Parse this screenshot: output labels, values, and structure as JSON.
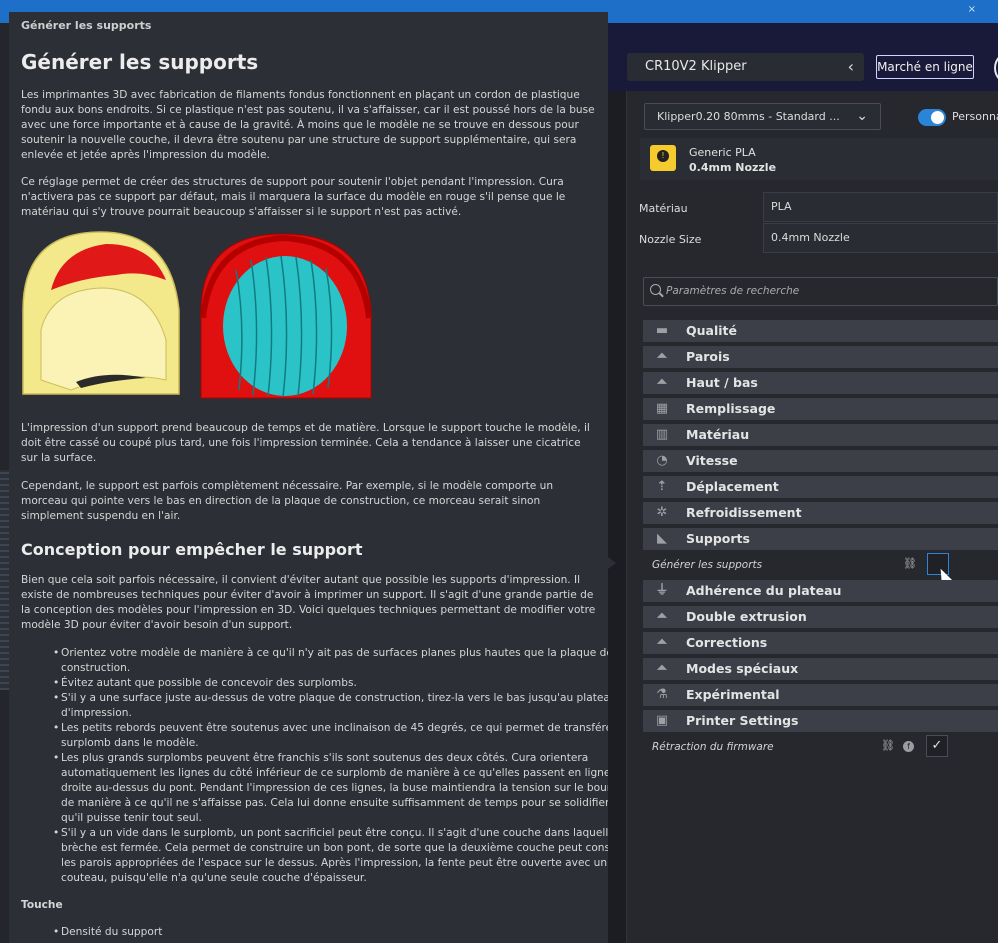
{
  "window": {
    "close_glyph": "×"
  },
  "header": {
    "printer_name": "CR10V2 Klipper",
    "marketplace_label": "Marché en ligne"
  },
  "tooltip": {
    "crumb": "Générer les supports",
    "title": "Générer les supports",
    "para1": "Les imprimantes 3D avec fabrication de filaments fondus fonctionnent en plaçant un cordon de plastique fondu aux bons endroits. Si ce plastique n'est pas soutenu, il va s'affaisser, car il est poussé hors de la buse avec une force importante et à cause de la gravité. À moins que le modèle ne se trouve en dessous pour soutenir la nouvelle couche, il devra être soutenu par une structure de support supplémentaire, qui sera enlevée et jetée après l'impression du modèle.",
    "para2": "Ce réglage permet de créer des structures de support pour soutenir l'objet pendant l'impression. Cura n'activera pas ce support par défaut, mais il marquera la surface du modèle en rouge s'il pense que le matériau qui s'y trouve pourrait beaucoup s'affaisser si le support n'est pas activé.",
    "para3": "L'impression d'un support prend beaucoup de temps et de matière. Lorsque le support touche le modèle, il doit être cassé ou coupé plus tard, une fois l'impression terminée. Cela a tendance à laisser une cicatrice sur la surface.",
    "para4": "Cependant, le support est parfois complètement nécessaire. Par exemple, si le modèle comporte un morceau qui pointe vers le bas en direction de la plaque de construction, ce morceau serait sinon simplement suspendu en l'air.",
    "heading2": "Conception pour empêcher le support",
    "para5": "Bien que cela soit parfois nécessaire, il convient d'éviter autant que possible les supports d'impression. Il existe de nombreuses techniques pour éviter d'avoir à imprimer un support. Il s'agit d'une grande partie de la conception des modèles pour l'impression en 3D. Voici quelques techniques permettant de modifier votre modèle 3D pour éviter d'avoir besoin d'un support.",
    "bullets": [
      "Orientez votre modèle de manière à ce qu'il n'y ait pas de surfaces planes plus hautes que la plaque de construction.",
      "Évitez autant que possible de concevoir des surplombs.",
      "S'il y a une surface juste au-dessus de votre plaque de construction, tirez-la vers le bas jusqu'au plateau d'impression.",
      "Les petits rebords peuvent être soutenus avec une inclinaison de 45 degrés, ce qui permet de transférer le surplomb dans le modèle.",
      "Les plus grands surplombs peuvent être franchis s'ils sont soutenus des deux côtés. Cura orientera automatiquement les lignes du côté inférieur de ce surplomb de manière à ce qu'elles passent en ligne droite au-dessus du pont. Pendant l'impression de ces lignes, la buse maintiendra la tension sur le bourrelet de manière à ce qu'il ne s'affaisse pas. Cela lui donne ensuite suffisamment de temps pour se solidifier afin qu'il puisse tenir tout seul.",
      "S'il y a un vide dans le surplomb, un pont sacrificiel peut être conçu. Il s'agit d'une couche dans laquelle la brèche est fermée. Cela permet de construire un bon pont, de sorte que la deuxième couche peut construire les parois appropriées de l'espace sur le dessus. Après l'impression, la fente peut être ouverte avec un couteau, puisqu'elle n'a qu'une seule couche d'épaisseur."
    ],
    "touch_heading": "Touche",
    "touch_items": [
      "Densité du support"
    ]
  },
  "settings": {
    "profile": "Klipper0.20 80mms - Standard ...",
    "custom_label": "Personna",
    "material_name": "Generic PLA",
    "material_nozzle": "0.4mm Nozzle",
    "material_label": "Matériau",
    "material_value": "PLA",
    "nozzle_label": "Nozzle Size",
    "nozzle_value": "0.4mm Nozzle",
    "search_placeholder": "Paramètres de recherche",
    "categories": [
      {
        "label": "Qualité",
        "icon": "quality-icon"
      },
      {
        "label": "Parois",
        "icon": "walls-icon"
      },
      {
        "label": "Haut / bas",
        "icon": "top-bottom-icon"
      },
      {
        "label": "Remplissage",
        "icon": "infill-icon"
      },
      {
        "label": "Matériau",
        "icon": "material-icon"
      },
      {
        "label": "Vitesse",
        "icon": "speed-icon"
      },
      {
        "label": "Déplacement",
        "icon": "travel-icon"
      },
      {
        "label": "Refroidissement",
        "icon": "cooling-icon"
      },
      {
        "label": "Supports",
        "icon": "support-icon"
      },
      {
        "label": "Adhérence du plateau",
        "icon": "adhesion-icon"
      },
      {
        "label": "Double extrusion",
        "icon": "dual-extrusion-icon"
      },
      {
        "label": "Corrections",
        "icon": "corrections-icon"
      },
      {
        "label": "Modes spéciaux",
        "icon": "special-modes-icon"
      },
      {
        "label": "Expérimental",
        "icon": "experimental-icon"
      },
      {
        "label": "Printer Settings",
        "icon": "printer-settings-icon"
      }
    ],
    "generate_support_label": "Générer les supports",
    "firmware_retraction_label": "Rétraction du firmware",
    "check_glyph": "✓",
    "warning_glyph": "!",
    "fw_glyph": "f"
  },
  "colors": {
    "accent": "#2a85d8",
    "titlebar": "#1e6fc8",
    "header": "#191a3a",
    "material": "#f5cb2d"
  }
}
